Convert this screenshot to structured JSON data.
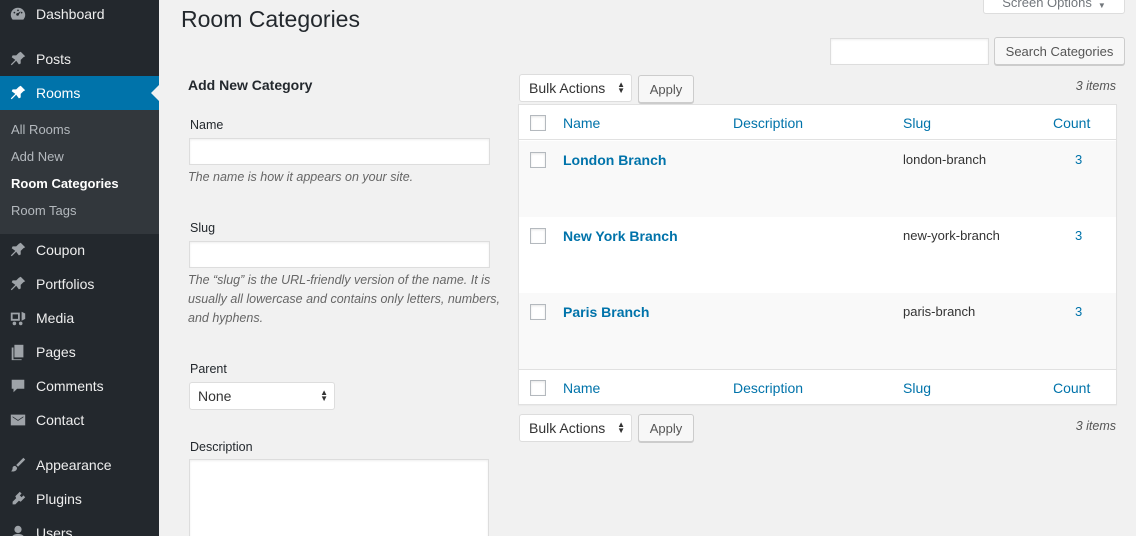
{
  "sidebar": {
    "items": [
      {
        "label": "Dashboard",
        "icon": "dashboard-icon"
      },
      {
        "label": "Posts",
        "icon": "pin-icon"
      },
      {
        "label": "Rooms",
        "icon": "pin-icon"
      },
      {
        "label": "Coupon",
        "icon": "pin-icon"
      },
      {
        "label": "Portfolios",
        "icon": "pin-icon"
      },
      {
        "label": "Media",
        "icon": "media-icon"
      },
      {
        "label": "Pages",
        "icon": "pages-icon"
      },
      {
        "label": "Comments",
        "icon": "comment-icon"
      },
      {
        "label": "Contact",
        "icon": "mail-icon"
      },
      {
        "label": "Appearance",
        "icon": "brush-icon"
      },
      {
        "label": "Plugins",
        "icon": "plug-icon"
      },
      {
        "label": "Users",
        "icon": "users-icon"
      }
    ],
    "submenu": [
      "All Rooms",
      "Add New",
      "Room Categories",
      "Room Tags"
    ],
    "active_item": "Rooms",
    "current_sub": "Room Categories"
  },
  "page": {
    "title": "Room Categories",
    "screen_options": "Screen Options",
    "search_button": "Search Categories",
    "search_value": ""
  },
  "form": {
    "title": "Add New Category",
    "name_label": "Name",
    "name_value": "",
    "name_help": "The name is how it appears on your site.",
    "slug_label": "Slug",
    "slug_value": "",
    "slug_help": "The “slug” is the URL-friendly version of the name. It is usually all lowercase and contains only letters, numbers, and hyphens.",
    "parent_label": "Parent",
    "parent_value": "None",
    "description_label": "Description"
  },
  "table": {
    "bulk_actions": "Bulk Actions",
    "apply": "Apply",
    "items_count": "3 items",
    "columns": [
      "Name",
      "Description",
      "Slug",
      "Count"
    ],
    "rows": [
      {
        "name": "London Branch",
        "description": "",
        "slug": "london-branch",
        "count": "3"
      },
      {
        "name": "New York Branch",
        "description": "",
        "slug": "new-york-branch",
        "count": "3"
      },
      {
        "name": "Paris Branch",
        "description": "",
        "slug": "paris-branch",
        "count": "3"
      }
    ]
  },
  "colors": {
    "accent": "#0073aa",
    "sidebar_bg": "#23282d",
    "submenu_bg": "#32373c"
  }
}
